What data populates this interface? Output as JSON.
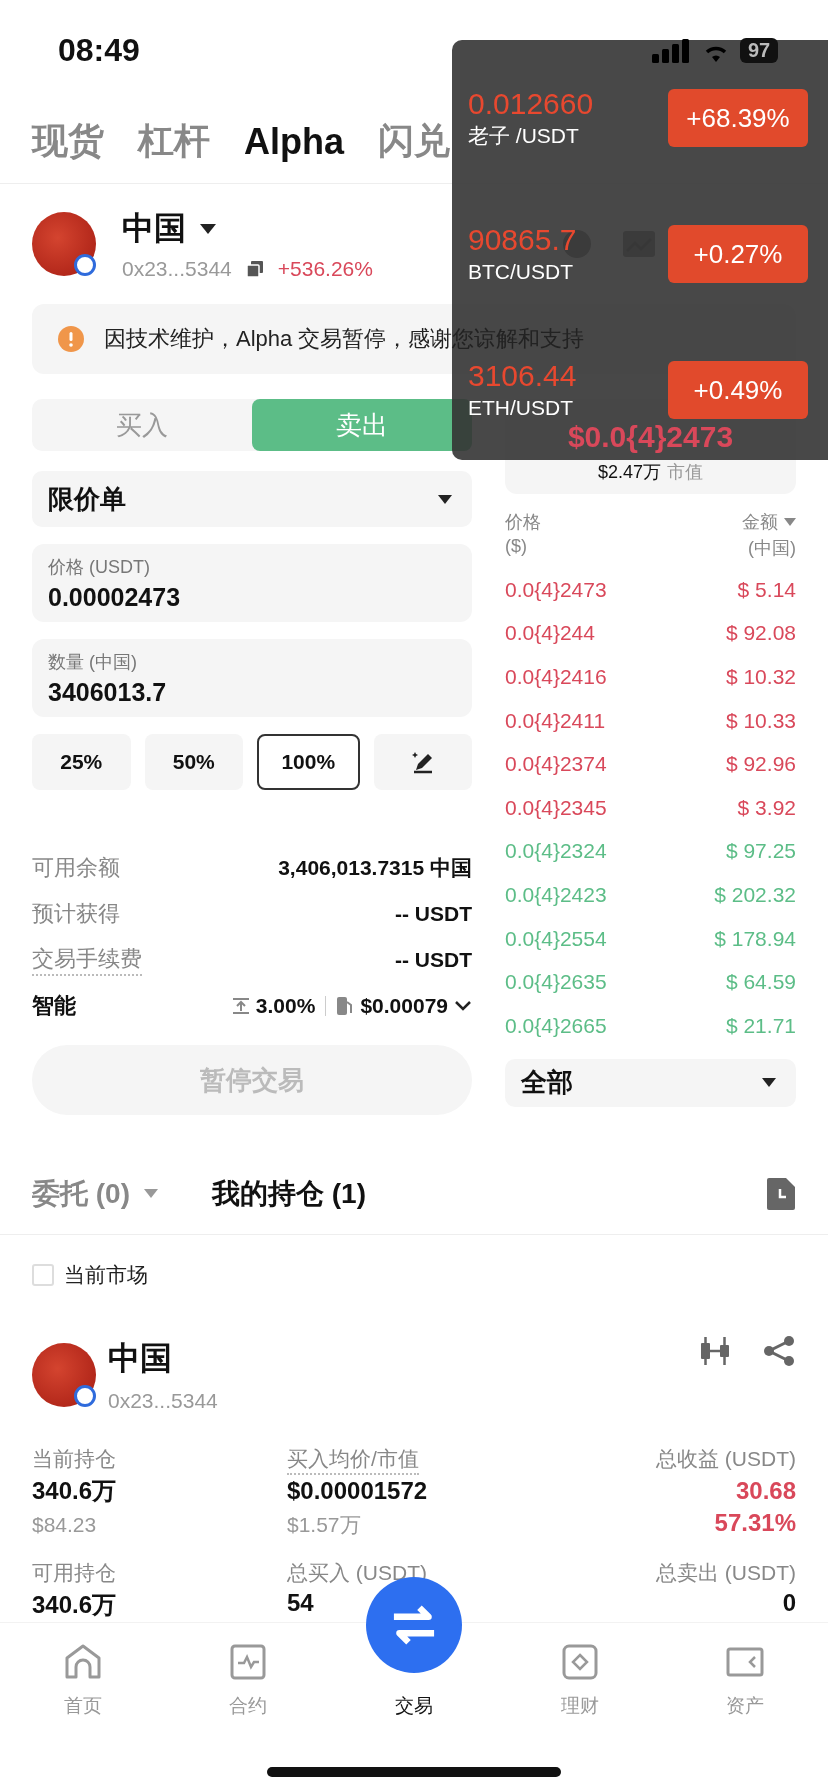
{
  "status_bar": {
    "time": "08:49",
    "battery": "97"
  },
  "tabs": [
    {
      "label": "现货",
      "selected": false
    },
    {
      "label": "杠杆",
      "selected": false
    },
    {
      "label": "Alpha",
      "selected": true
    },
    {
      "label": "闪兑",
      "selected": false
    }
  ],
  "token": {
    "name": "中国",
    "address": "0x23...5344",
    "change": "+536.26%"
  },
  "notice": {
    "text": "因技术维护，Alpha 交易暂停，感谢您谅解和支持"
  },
  "side_toggle": [
    {
      "label": "买入",
      "selected": false
    },
    {
      "label": "卖出",
      "selected": true
    }
  ],
  "order_type": {
    "value": "限价单"
  },
  "price_field": {
    "label": "价格 (USDT)",
    "value": "0.00002473"
  },
  "quantity_field": {
    "label": "数量 (中国)",
    "value": "3406013.7"
  },
  "percent_buttons": [
    {
      "label": "25%",
      "selected": false
    },
    {
      "label": "50%",
      "selected": false
    },
    {
      "label": "100%",
      "selected": true
    }
  ],
  "summary": [
    {
      "label": "可用余额",
      "value": "3,406,013.7315 中国",
      "dotted": false
    },
    {
      "label": "预计获得",
      "value": "-- USDT",
      "dotted": false
    },
    {
      "label": "交易手续费",
      "value": "-- USDT",
      "dotted": true
    }
  ],
  "slippage": {
    "label": "智能",
    "slippage": "3.00%",
    "gas": "$0.00079"
  },
  "submit": {
    "label": "暂停交易",
    "disabled": true
  },
  "orderbook": {
    "last_price": "$0.0{4}2473",
    "market_cap": "$2.47万",
    "market_cap_label": "市值",
    "price_header": "价格",
    "price_unit": "($)",
    "amount_header": "金额",
    "amount_unit": "(中国)",
    "rows": [
      {
        "price": "0.0{4}2473",
        "amount": "$ 5.14",
        "color": "#d9485a"
      },
      {
        "price": "0.0{4}244",
        "amount": "$ 92.08",
        "color": "#d9485a"
      },
      {
        "price": "0.0{4}2416",
        "amount": "$ 10.32",
        "color": "#d9485a"
      },
      {
        "price": "0.0{4}2411",
        "amount": "$ 10.33",
        "color": "#d9485a"
      },
      {
        "price": "0.0{4}2374",
        "amount": "$ 92.96",
        "color": "#d9485a"
      },
      {
        "price": "0.0{4}2345",
        "amount": "$ 3.92",
        "color": "#d9485a"
      },
      {
        "price": "0.0{4}2324",
        "amount": "$ 97.25",
        "color": "#5cbd87"
      },
      {
        "price": "0.0{4}2423",
        "amount": "$ 202.32",
        "color": "#5cbd87"
      },
      {
        "price": "0.0{4}2554",
        "amount": "$ 178.94",
        "color": "#5cbd87"
      },
      {
        "price": "0.0{4}2635",
        "amount": "$ 64.59",
        "color": "#5cbd87"
      },
      {
        "price": "0.0{4}2665",
        "amount": "$ 21.71",
        "color": "#5cbd87"
      }
    ],
    "filter": "全部"
  },
  "bottom_tabs": [
    {
      "label": "委托 (0)",
      "selected": false
    },
    {
      "label": "我的持仓 (1)",
      "selected": true
    }
  ],
  "current_market": {
    "label": "当前市场",
    "checked": false
  },
  "position": {
    "name": "中国",
    "address": "0x23...5344",
    "stats": [
      {
        "label": "当前持仓",
        "dotted": false,
        "kind": "plain",
        "values": [
          "340.6万",
          "$84.23"
        ]
      },
      {
        "label": "买入均价/市值",
        "dotted": true,
        "kind": "plain",
        "values": [
          "$0.00001572",
          "$1.57万"
        ]
      },
      {
        "label": "总收益 (USDT)",
        "dotted": false,
        "kind": "profit",
        "values": [
          "30.68",
          "57.31%"
        ]
      },
      {
        "label": "可用持仓",
        "dotted": false,
        "kind": "plain",
        "values": [
          "340.6万"
        ]
      },
      {
        "label": "总买入 (USDT)",
        "dotted": false,
        "kind": "plain",
        "values": [
          "54"
        ]
      },
      {
        "label": "总卖出 (USDT)",
        "dotted": false,
        "kind": "plain",
        "values": [
          "0"
        ]
      }
    ]
  },
  "nav": [
    {
      "label": "首页",
      "selected": false
    },
    {
      "label": "合约",
      "selected": false
    },
    {
      "label": "交易",
      "selected": true
    },
    {
      "label": "理财",
      "selected": false
    },
    {
      "label": "资产",
      "selected": false
    }
  ],
  "ticker_popup": [
    {
      "price": "0.012660",
      "pair": "老子 /USDT",
      "change": "+68.39%"
    },
    {
      "price": "90865.7",
      "pair": "BTC/USDT",
      "change": "+0.27%"
    },
    {
      "price": "3106.44",
      "pair": "ETH/USDT",
      "change": "+0.49%"
    }
  ]
}
